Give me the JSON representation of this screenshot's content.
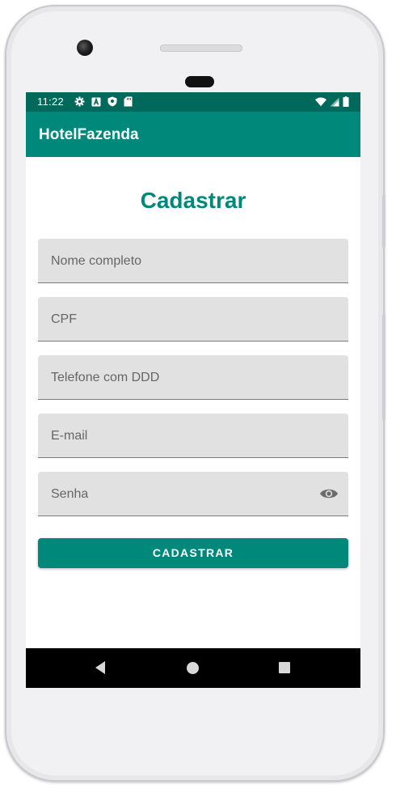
{
  "status_bar": {
    "time": "11:22",
    "left_icons": [
      "gear-icon",
      "a-icon",
      "shield-icon",
      "sd-card-icon"
    ],
    "right_icons": [
      "wifi-icon",
      "signal-icon",
      "battery-icon"
    ]
  },
  "app_bar": {
    "title": "HotelFazenda"
  },
  "form": {
    "title": "Cadastrar",
    "fields": [
      {
        "placeholder": "Nome completo"
      },
      {
        "placeholder": "CPF"
      },
      {
        "placeholder": "Telefone com DDD"
      },
      {
        "placeholder": "E-mail"
      },
      {
        "placeholder": "Senha"
      }
    ],
    "submit_label": "CADASTRAR"
  },
  "colors": {
    "primary": "#00897b",
    "primary_dark": "#00695c",
    "field_bg": "#e1e1e1"
  }
}
